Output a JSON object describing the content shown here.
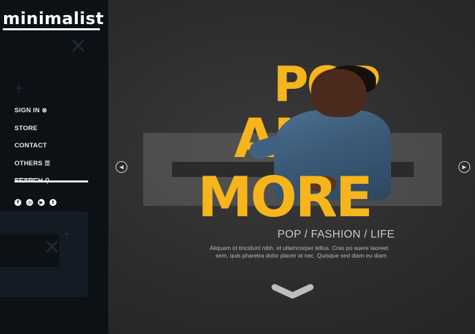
{
  "brand": {
    "logo_text": "minimalist"
  },
  "nav": {
    "items": [
      {
        "label": "SIGN IN",
        "icon": "close-circle-icon",
        "glyph": "⊗"
      },
      {
        "label": "STORE",
        "icon": "",
        "glyph": ""
      },
      {
        "label": "CONTACT",
        "icon": "",
        "glyph": ""
      },
      {
        "label": "OTHERS",
        "icon": "menu-icon",
        "glyph": "☰"
      },
      {
        "label": "SEARCH",
        "icon": "search-icon",
        "glyph": "⚲"
      }
    ]
  },
  "socials": [
    {
      "name": "facebook-icon",
      "glyph": "f"
    },
    {
      "name": "instagram-icon",
      "glyph": "◎"
    },
    {
      "name": "youtube-icon",
      "glyph": "▶"
    },
    {
      "name": "twitter-icon",
      "glyph": "t"
    }
  ],
  "hero": {
    "line1": "POP",
    "line2": "AND",
    "line3": "MORE",
    "tagline": "POP / FASHION / LIFE",
    "description": "Aliquam id tincidunt nibh, et ullamcorper tellus. Cras po suere laoreet sem, quis pharetra dolor placer at nec. Quisque sed diam eu diam.",
    "prev_glyph": "◀",
    "next_glyph": "▶"
  },
  "colors": {
    "accent": "#f6b41d",
    "sidebar": "#0c1116",
    "background": "#2c2c2c"
  }
}
